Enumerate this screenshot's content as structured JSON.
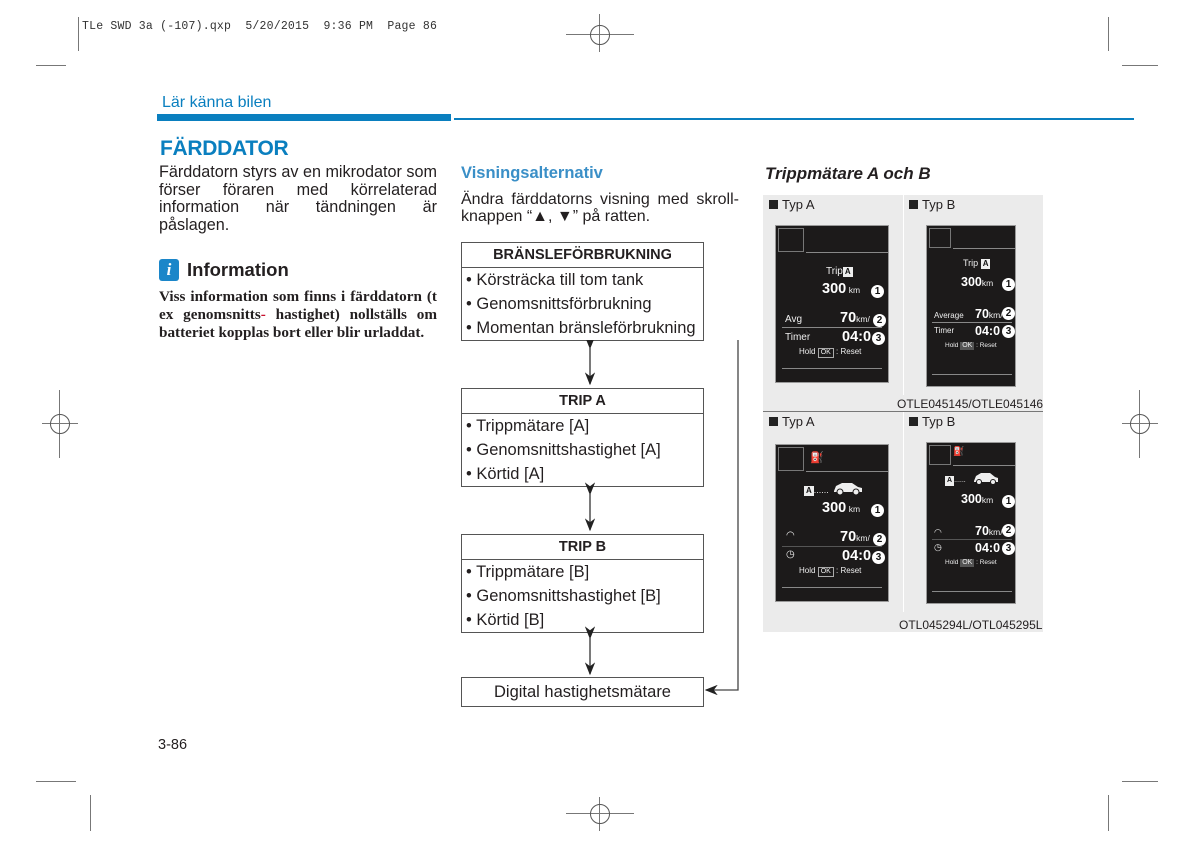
{
  "print_slug": "TLe SWD 3a (-107).qxp  5/20/2015  9:36 PM  Page 86",
  "header": {
    "section": "Lär känna bilen"
  },
  "left_column": {
    "title": "FÄRDDATOR",
    "paragraph": "Färddatorn styrs av en mikrodator som förser föraren med körrelaterad information när tändningen är påslagen.",
    "info": {
      "icon": "info-icon",
      "icon_glyph": "i",
      "title": "Information",
      "body_before": "Viss information som finns i färddatorn (t ex genomsnitts",
      "body_hyphen": "-",
      "body_after": "hastighet) nollställs om batteriet kopplas bort eller blir urladdat."
    }
  },
  "middle_column": {
    "title": "Visningsalternativ",
    "paragraph": "Ändra färddatorns visning med skroll-knappen “▲, ▼” på ratten.",
    "flow": [
      {
        "header": "BRÄNSLEFÖRBRUKNING",
        "items": [
          "• Körsträcka till tom tank",
          "• Genomsnittsförbrukning",
          "• Momentan bränsleförbrukning"
        ]
      },
      {
        "header": "TRIP A",
        "items": [
          "• Trippmätare [A]",
          "• Genomsnittshastighet [A]",
          "• Körtid [A]"
        ]
      },
      {
        "header": "TRIP B",
        "items": [
          "• Trippmätare [B]",
          "• Genomsnittshastighet [B]",
          "• Körtid [B]"
        ]
      },
      {
        "label": "Digital hastighetsmätare"
      }
    ]
  },
  "right_column": {
    "title": "Trippmätare A och B",
    "panels": [
      {
        "caption": "OTLE045145/OTLE045146",
        "screens": [
          {
            "type_label": "Typ A",
            "trip_label": "Trip",
            "trip_tag": "A",
            "distance": "300",
            "distance_unit": "km",
            "avg_label": "Avg",
            "speed": "70",
            "speed_unit": "km/",
            "timer_label": "Timer",
            "time": "04:0",
            "hold": "Hold",
            "ok": "OK",
            "reset": ": Reset",
            "markers": [
              "1",
              "2",
              "3"
            ]
          },
          {
            "type_label": "Typ B",
            "trip_label": "Trip",
            "trip_tag": "A",
            "distance": "300",
            "distance_unit": "km",
            "avg_label": "Average",
            "speed": "70",
            "speed_unit": "km/",
            "timer_label": "Timer",
            "time": "04:0",
            "hold": "Hold",
            "ok": "OK",
            "reset": ": Reset",
            "markers": [
              "1",
              "2",
              "3"
            ]
          }
        ]
      },
      {
        "caption": "OTL045294L/OTL045295L",
        "screens": [
          {
            "type_label": "Typ A",
            "trip_tag": "A",
            "dots": "......",
            "distance": "300",
            "distance_unit": "km",
            "speed": "70",
            "speed_unit": "km/",
            "time": "04:0",
            "hold": "Hold",
            "ok": "OK",
            "reset": ": Reset",
            "markers": [
              "1",
              "2",
              "3"
            ]
          },
          {
            "type_label": "Typ B",
            "trip_tag": "A",
            "dots": "......",
            "distance": "300",
            "distance_unit": "km",
            "speed": "70",
            "speed_unit": "km/",
            "time": "04:0",
            "hold": "Hold",
            "ok": "OK",
            "reset": ": Reset",
            "markers": [
              "1",
              "2",
              "3"
            ]
          }
        ]
      }
    ]
  },
  "footer": {
    "page_number": "3-86"
  },
  "colors": {
    "accent": "#0a7fbf",
    "subhead": "#3a8fc7",
    "info_badge": "#1b86c9",
    "hyphen_red": "#c8102e",
    "screen_bg": "#1c1a1a",
    "panel_bg": "#ebebeb"
  }
}
